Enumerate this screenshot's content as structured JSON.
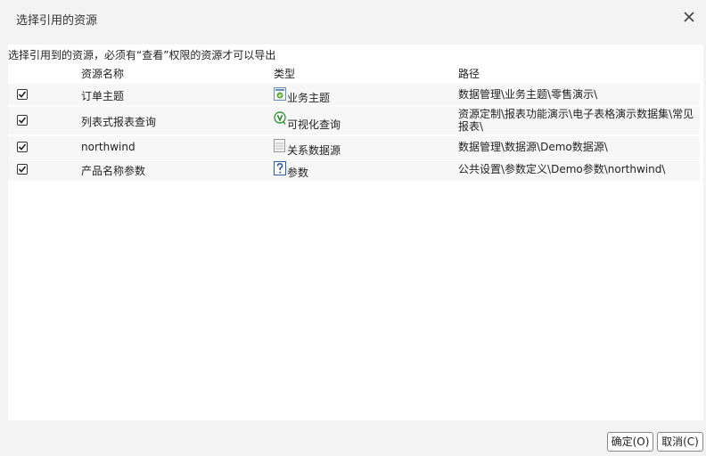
{
  "dialog": {
    "title": "选择引用的资源"
  },
  "hint": "选择引用到的资源，必须有“查看”权限的资源才可以导出",
  "columns": {
    "name": "资源名称",
    "type": "类型",
    "path": "路径"
  },
  "rows": [
    {
      "checked": true,
      "name": "订单主题",
      "type": "业务主题",
      "type_icon": "business-theme-icon",
      "path": "数据管理\\业务主题\\零售演示\\"
    },
    {
      "checked": true,
      "name": "列表式报表查询",
      "type": "可视化查询",
      "type_icon": "visual-query-icon",
      "path": "资源定制\\报表功能演示\\电子表格演示数据集\\常见报表\\"
    },
    {
      "checked": true,
      "name": "northwind",
      "type": "关系数据源",
      "type_icon": "relational-datasource-icon",
      "path": "数据管理\\数据源\\Demo数据源\\"
    },
    {
      "checked": true,
      "name": "产品名称参数",
      "type": "参数",
      "type_icon": "parameter-icon",
      "path": "公共设置\\参数定义\\Demo参数\\northwind\\"
    }
  ],
  "buttons": {
    "ok": "确定(O)",
    "cancel": "取消(C)"
  }
}
